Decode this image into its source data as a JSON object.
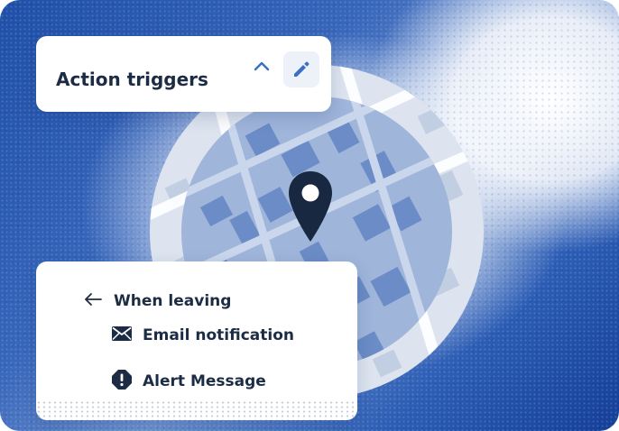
{
  "header_card": {
    "title": "Action triggers",
    "collapse_icon": "chevron-up-icon",
    "edit_icon": "pencil-icon"
  },
  "map": {
    "pin_icon": "map-pin-icon"
  },
  "trigger_card": {
    "leaving_label": "When leaving",
    "leaving_icon": "arrow-left-icon",
    "actions": [
      {
        "label": "Email notification",
        "icon": "envelope-icon"
      },
      {
        "label": "Alert Message",
        "icon": "alert-octagon-icon"
      }
    ]
  },
  "colors": {
    "accent": "#3b6fc4",
    "text_dark": "#1c2c45",
    "pin": "#172840",
    "map_circle": "#9fb5da",
    "background_blue": "#1f4fa8"
  }
}
